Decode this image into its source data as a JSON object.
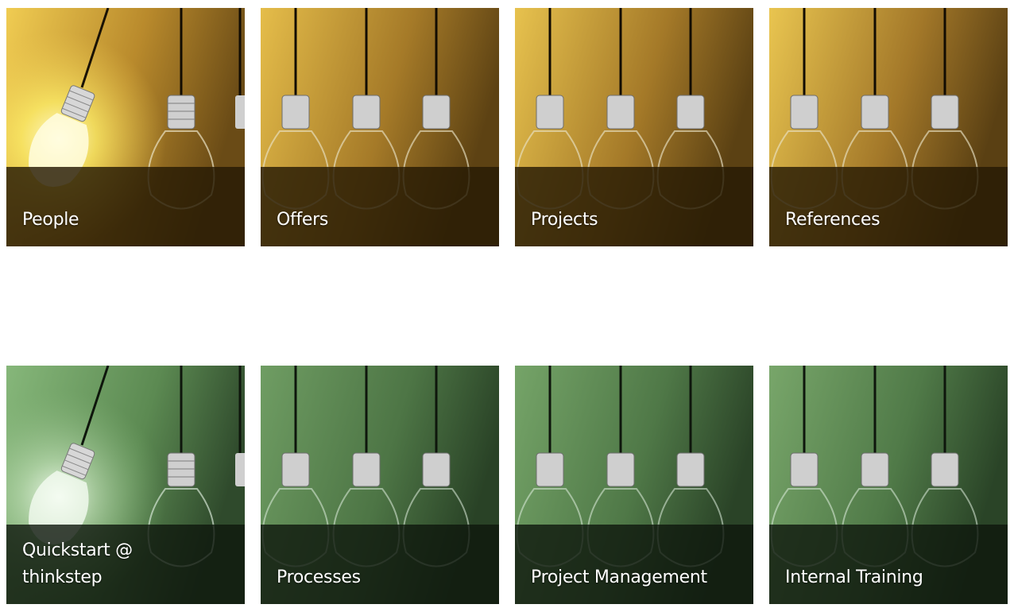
{
  "theme": {
    "gold_light": "#f1cf5a",
    "gold_dark": "#6b4c17",
    "green_light": "#7fae70",
    "green_dark": "#2f4a2c"
  },
  "tiles": [
    {
      "label": "People",
      "theme": "gold",
      "lit": true
    },
    {
      "label": "Offers",
      "theme": "gold",
      "lit": false
    },
    {
      "label": "Projects",
      "theme": "gold",
      "lit": false
    },
    {
      "label": "References",
      "theme": "gold",
      "lit": false
    },
    {
      "label": "Quickstart @ thinkstep",
      "theme": "green",
      "lit": true
    },
    {
      "label": "Processes",
      "theme": "green",
      "lit": false
    },
    {
      "label": "Project Management",
      "theme": "green",
      "lit": false
    },
    {
      "label": "Internal Training",
      "theme": "green",
      "lit": false
    }
  ]
}
